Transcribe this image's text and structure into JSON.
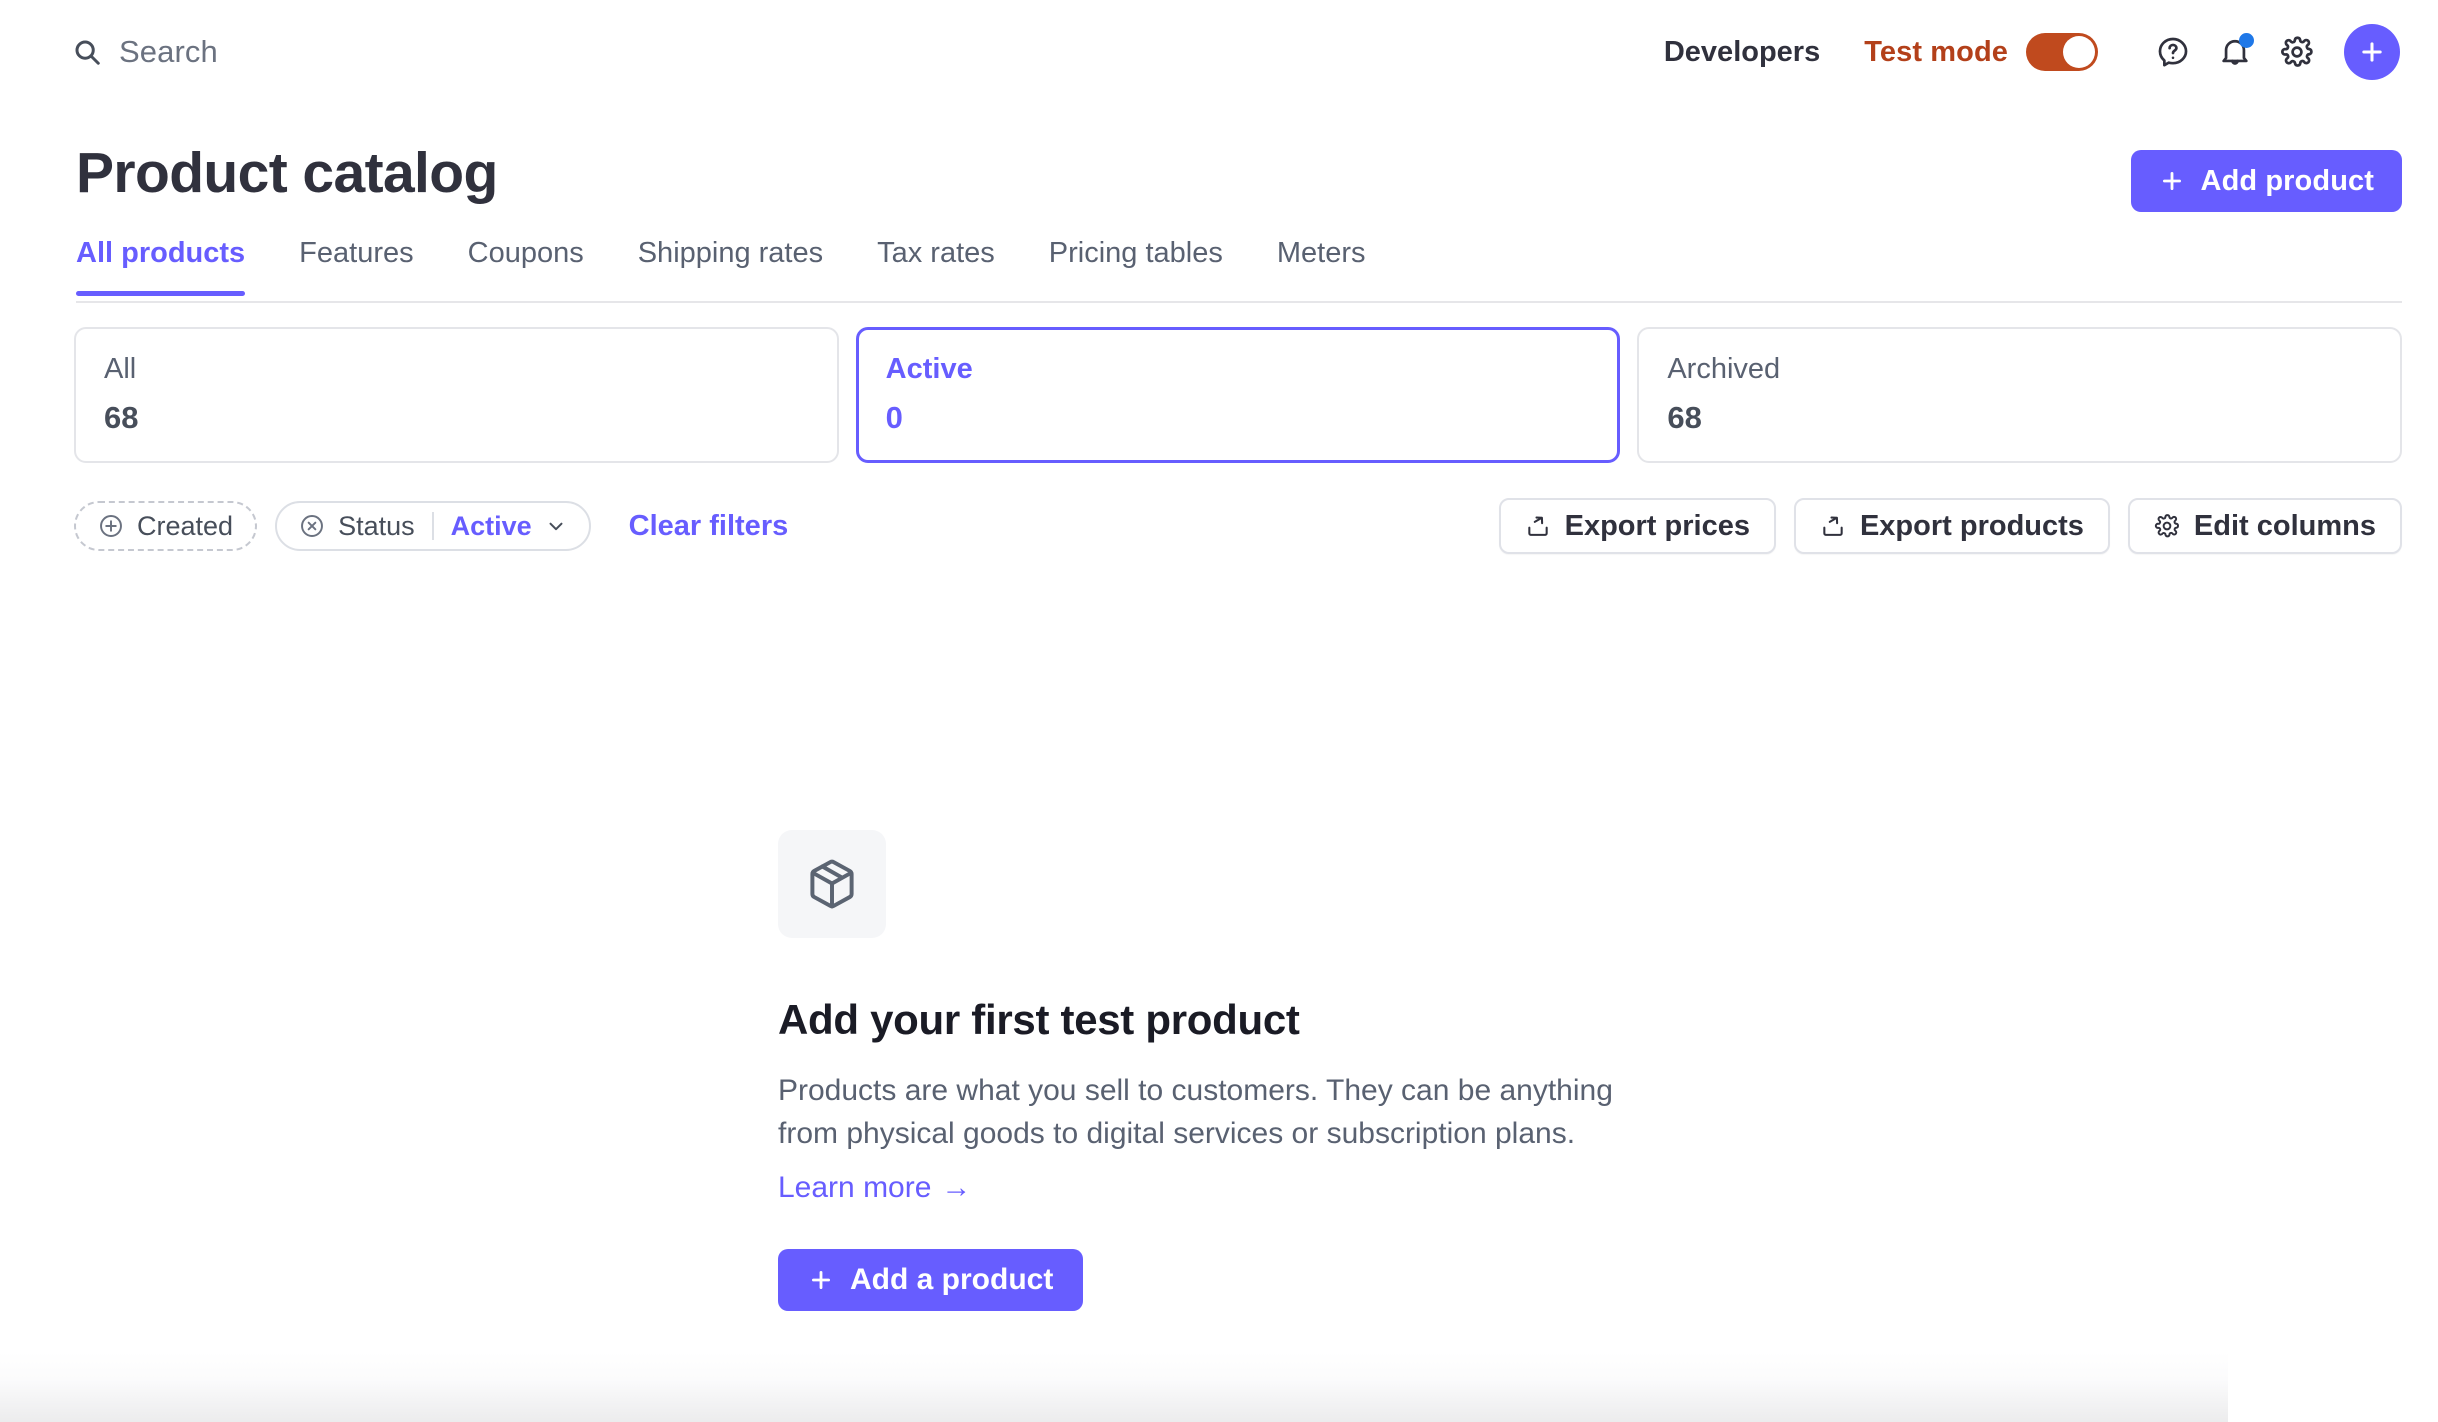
{
  "topbar": {
    "search": {
      "icon": "search-icon",
      "placeholder": "Search"
    },
    "developers_label": "Developers",
    "test_mode": {
      "label": "Test mode",
      "enabled": true,
      "color": "#c04a1e"
    },
    "icons": [
      {
        "name": "help-icon",
        "label": "Help"
      },
      {
        "name": "notifications-icon",
        "label": "Notifications",
        "has_dot": true,
        "dot_color": "#1f78e8"
      },
      {
        "name": "settings-icon",
        "label": "Settings"
      },
      {
        "name": "create-icon",
        "label": "Create"
      }
    ]
  },
  "header": {
    "title": "Product catalog",
    "add_product_label": "Add product",
    "accent": "#675dff"
  },
  "tabs": [
    {
      "label": "All products",
      "active": true
    },
    {
      "label": "Features",
      "active": false
    },
    {
      "label": "Coupons",
      "active": false
    },
    {
      "label": "Shipping rates",
      "active": false
    },
    {
      "label": "Tax rates",
      "active": false
    },
    {
      "label": "Pricing tables",
      "active": false
    },
    {
      "label": "Meters",
      "active": false
    }
  ],
  "stat_cards": [
    {
      "label": "All",
      "value": "68",
      "selected": false
    },
    {
      "label": "Active",
      "value": "0",
      "selected": true
    },
    {
      "label": "Archived",
      "value": "68",
      "selected": false
    }
  ],
  "filters": {
    "created_chip": {
      "label": "Created",
      "icon": "plus-circle-icon"
    },
    "status_chip": {
      "icon": "x-circle-icon",
      "label": "Status",
      "value": "Active"
    },
    "clear_filters_label": "Clear filters",
    "actions": [
      {
        "label": "Export prices",
        "icon": "export-icon"
      },
      {
        "label": "Export products",
        "icon": "export-icon"
      },
      {
        "label": "Edit columns",
        "icon": "gear-icon"
      }
    ]
  },
  "empty_state": {
    "icon": "package-box-icon",
    "title": "Add your first test product",
    "description": "Products are what you sell to customers. They can be anything from physical goods to digital services or subscription plans.",
    "learn_more_label": "Learn more",
    "learn_more_arrow": "→",
    "cta_label": "Add a product"
  }
}
